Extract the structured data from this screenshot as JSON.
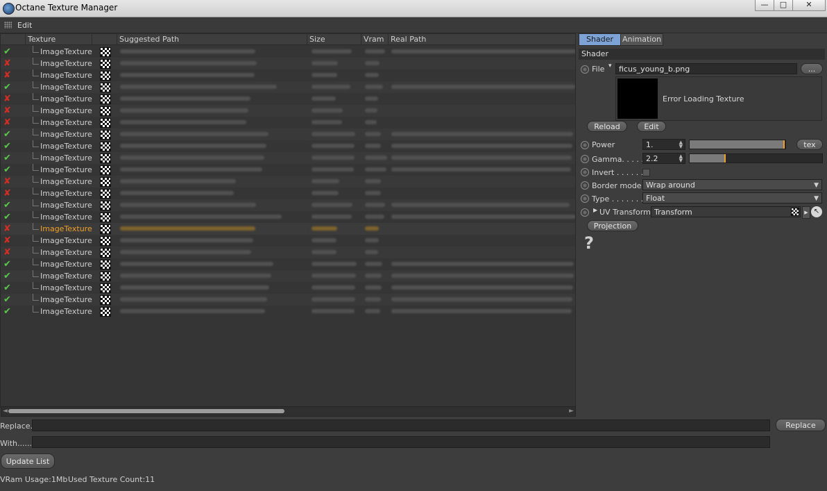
{
  "window": {
    "title": "Octane Texture Manager",
    "min_glyph": "—",
    "max_glyph": "□",
    "close_glyph": "✕"
  },
  "menu": {
    "edit": "Edit"
  },
  "table": {
    "columns": {
      "texture": "Texture",
      "suggested_path": "Suggested Path",
      "size": "Size",
      "vram": "Vram",
      "real_path": "Real Path"
    },
    "rows": [
      {
        "status": "ok",
        "name": "ImageTexture"
      },
      {
        "status": "bad",
        "name": "ImageTexture"
      },
      {
        "status": "bad",
        "name": "ImageTexture"
      },
      {
        "status": "ok",
        "name": "ImageTexture"
      },
      {
        "status": "bad",
        "name": "ImageTexture"
      },
      {
        "status": "bad",
        "name": "ImageTexture"
      },
      {
        "status": "bad",
        "name": "ImageTexture"
      },
      {
        "status": "ok",
        "name": "ImageTexture"
      },
      {
        "status": "ok",
        "name": "ImageTexture"
      },
      {
        "status": "ok",
        "name": "ImageTexture"
      },
      {
        "status": "ok",
        "name": "ImageTexture"
      },
      {
        "status": "bad",
        "name": "ImageTexture"
      },
      {
        "status": "bad",
        "name": "ImageTexture"
      },
      {
        "status": "ok",
        "name": "ImageTexture"
      },
      {
        "status": "ok",
        "name": "ImageTexture"
      },
      {
        "status": "bad",
        "name": "ImageTexture",
        "selected": true
      },
      {
        "status": "bad",
        "name": "ImageTexture"
      },
      {
        "status": "bad",
        "name": "ImageTexture"
      },
      {
        "status": "ok",
        "name": "ImageTexture"
      },
      {
        "status": "ok",
        "name": "ImageTexture"
      },
      {
        "status": "ok",
        "name": "ImageTexture"
      },
      {
        "status": "ok",
        "name": "ImageTexture"
      },
      {
        "status": "ok",
        "name": "ImageTexture"
      }
    ]
  },
  "scroll": {
    "left_arrow": "◄",
    "right_arrow": "►"
  },
  "shader": {
    "tabs": {
      "shader": "Shader",
      "animation": "Animation"
    },
    "section_title": "Shader",
    "file_label": "File",
    "file_value": "ficus_young_b.png",
    "browse_label": "...",
    "preview_message": "Error Loading Texture",
    "reload_label": "Reload",
    "edit_label": "Edit",
    "power_label": "Power",
    "power_value": "1.",
    "power_fraction": 0.98,
    "tex_label": "tex",
    "gamma_label": "Gamma. . . . .",
    "gamma_value": "2.2",
    "gamma_fraction": 0.26,
    "invert_label": "Invert . . . . . .",
    "border_label": "Border mode",
    "border_value": "Wrap around",
    "type_label": "Type . . . . . . .",
    "type_value": "Float",
    "uv_label": "UV Transform",
    "uv_value": "Transform",
    "projection_label": "Projection",
    "help_glyph": "?"
  },
  "bottom": {
    "replace_label": "Replace.",
    "with_label": "With......",
    "replace_button": "Replace",
    "update_button": "Update List",
    "vram_usage": "VRam Usage:1Mb",
    "texture_count": "Used Texture Count:11"
  },
  "colors": {
    "ok": "#59c94a",
    "bad": "#d42d23",
    "accent": "#f0a026",
    "tab_active": "#7da3d6"
  }
}
